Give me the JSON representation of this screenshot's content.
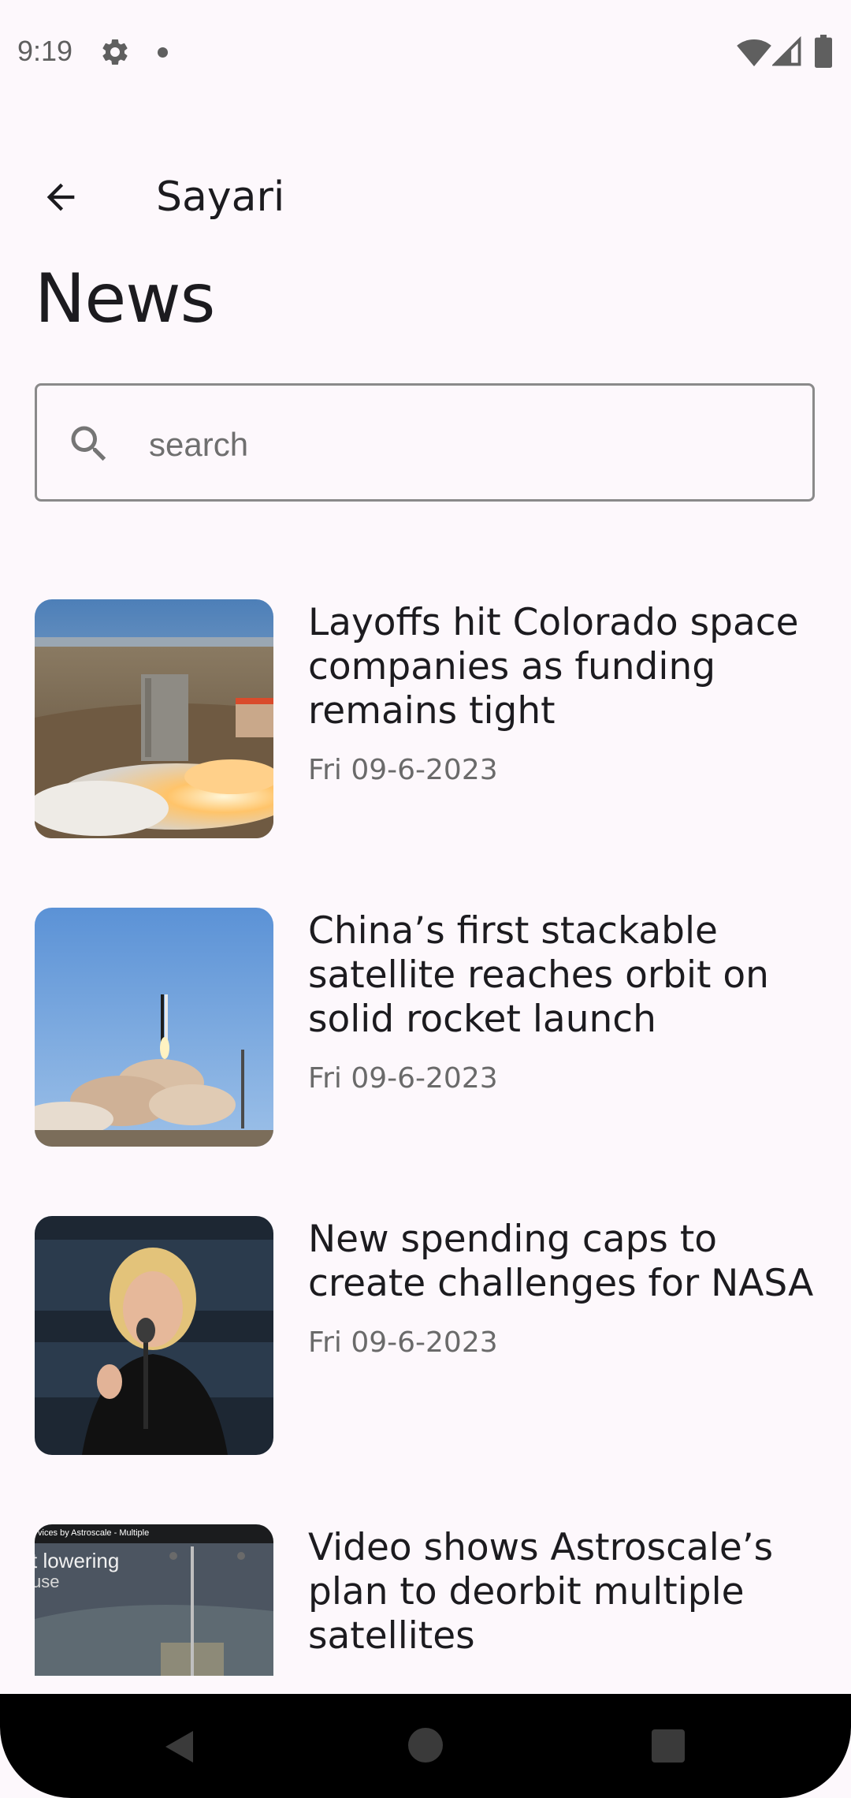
{
  "status_bar": {
    "time": "9:19",
    "icons": [
      "gear-icon",
      "notification-dot-icon",
      "wifi-icon",
      "signal-icon",
      "battery-icon"
    ]
  },
  "top_bar": {
    "back_icon": "arrow-back-icon",
    "title": "Sayari"
  },
  "page": {
    "title": "News"
  },
  "search": {
    "icon": "search-icon",
    "placeholder": "search",
    "value": ""
  },
  "news": {
    "items": [
      {
        "title": "Layoffs hit Colorado space companies as funding remains tight",
        "date": "Fri 09-6-2023",
        "image": "rocket-engine-test-image"
      },
      {
        "title": "China’s first stackable satellite reaches orbit on solid rocket launch",
        "date": "Fri 09-6-2023",
        "image": "rocket-launch-image"
      },
      {
        "title": "New spending caps to create challenges for NASA",
        "date": "Fri 09-6-2023",
        "image": "speaker-photo-image"
      },
      {
        "title": "Video shows Astroscale’s plan to deorbit multiple satellites",
        "date": "",
        "image": "satellite-video-image"
      }
    ]
  },
  "thumb_caption": {
    "line1": "vices by Astroscale - Multiple",
    "line2": "t lowering",
    "line3": "use"
  },
  "nav_bar": {
    "icons": [
      "nav-back-icon",
      "nav-home-icon",
      "nav-recents-icon"
    ]
  },
  "colors": {
    "background": "#fdf8fc",
    "text_primary": "#1c1b1f",
    "text_secondary": "#6a6a6a",
    "outline": "#8a8a8a"
  }
}
